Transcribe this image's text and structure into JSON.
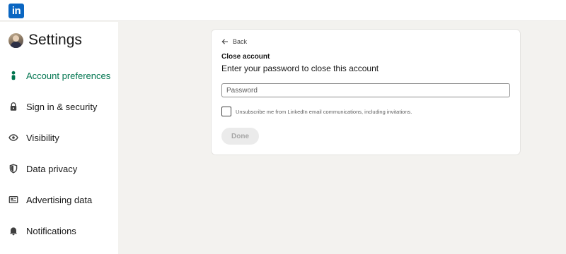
{
  "header": {
    "logo_text": "in",
    "logo_color": "#0a66c2"
  },
  "sidebar": {
    "title": "Settings",
    "items": [
      {
        "label": "Account preferences",
        "icon": "person-icon",
        "active": true
      },
      {
        "label": "Sign in & security",
        "icon": "lock-icon",
        "active": false
      },
      {
        "label": "Visibility",
        "icon": "eye-icon",
        "active": false
      },
      {
        "label": "Data privacy",
        "icon": "shield-icon",
        "active": false
      },
      {
        "label": "Advertising data",
        "icon": "newspaper-icon",
        "active": false
      },
      {
        "label": "Notifications",
        "icon": "bell-icon",
        "active": false
      }
    ],
    "active_color": "#01754f"
  },
  "main": {
    "back_label": "Back",
    "title": "Close account",
    "subtitle": "Enter your password to close this account",
    "password": {
      "placeholder": "Password",
      "value": ""
    },
    "unsubscribe": {
      "label": "Unsubscribe me from LinkedIn email communications, including invitations.",
      "checked": false
    },
    "done_label": "Done",
    "done_disabled": true
  }
}
